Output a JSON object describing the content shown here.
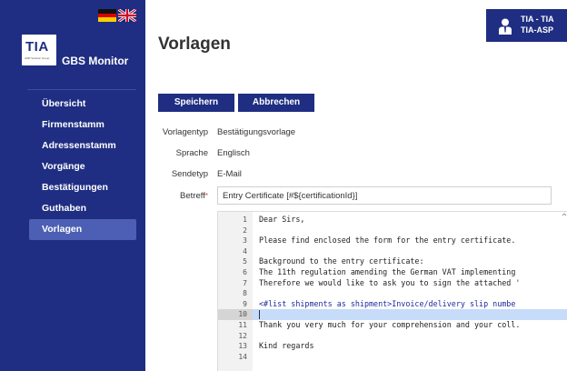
{
  "window": {
    "title": "Vorlagen"
  },
  "brand": {
    "logo_text": "TIA",
    "logo_sub": "AMP Solution Group",
    "app_name": "GBS Monitor"
  },
  "languages": [
    "de",
    "en"
  ],
  "user": {
    "line1": "TIA - TIA",
    "line2": "TIA-ASP"
  },
  "sidebar": {
    "items": [
      {
        "label": "Übersicht",
        "active": false
      },
      {
        "label": "Firmenstamm",
        "active": false
      },
      {
        "label": "Adressenstamm",
        "active": false
      },
      {
        "label": "Vorgänge",
        "active": false
      },
      {
        "label": "Bestätigungen",
        "active": false
      },
      {
        "label": "Guthaben",
        "active": false
      },
      {
        "label": "Vorlagen",
        "active": true
      }
    ]
  },
  "actions": {
    "save_label": "Speichern",
    "cancel_label": "Abbrechen"
  },
  "form": {
    "template_type": {
      "label": "Vorlagentyp",
      "value": "Bestätigungsvorlage"
    },
    "language": {
      "label": "Sprache",
      "value": "Englisch"
    },
    "send_type": {
      "label": "Sendetyp",
      "value": "E-Mail"
    },
    "subject": {
      "label": "Betreff",
      "required_mark": "*",
      "value": "Entry Certificate [#${certificationId}]"
    }
  },
  "editor": {
    "current_line": 10,
    "lines": [
      {
        "num": "1",
        "text": "Dear Sirs,"
      },
      {
        "num": "2",
        "text": ""
      },
      {
        "num": "3",
        "text": "Please find enclosed the form for the entry certificate."
      },
      {
        "num": "4",
        "text": ""
      },
      {
        "num": "5",
        "text": "Background to the entry certificate:"
      },
      {
        "num": "6",
        "text": "The 11th regulation amending the German VAT implementing"
      },
      {
        "num": "7",
        "text": "Therefore we would like to ask you to sign the attached '"
      },
      {
        "num": "8",
        "text": ""
      },
      {
        "num": "9",
        "text": "<#list shipments as shipment>Invoice/delivery slip numbe"
      },
      {
        "num": "10",
        "text": ""
      },
      {
        "num": "11",
        "text": "Thank you very much for your comprehension and your coll."
      },
      {
        "num": "12",
        "text": ""
      },
      {
        "num": "13",
        "text": "Kind regards"
      },
      {
        "num": "14",
        "text": ""
      }
    ]
  },
  "colors": {
    "primary": "#1f2e82",
    "active_menu": "#4d5fb4",
    "current_line": "#c7dcf9",
    "required": "#e0443c"
  }
}
